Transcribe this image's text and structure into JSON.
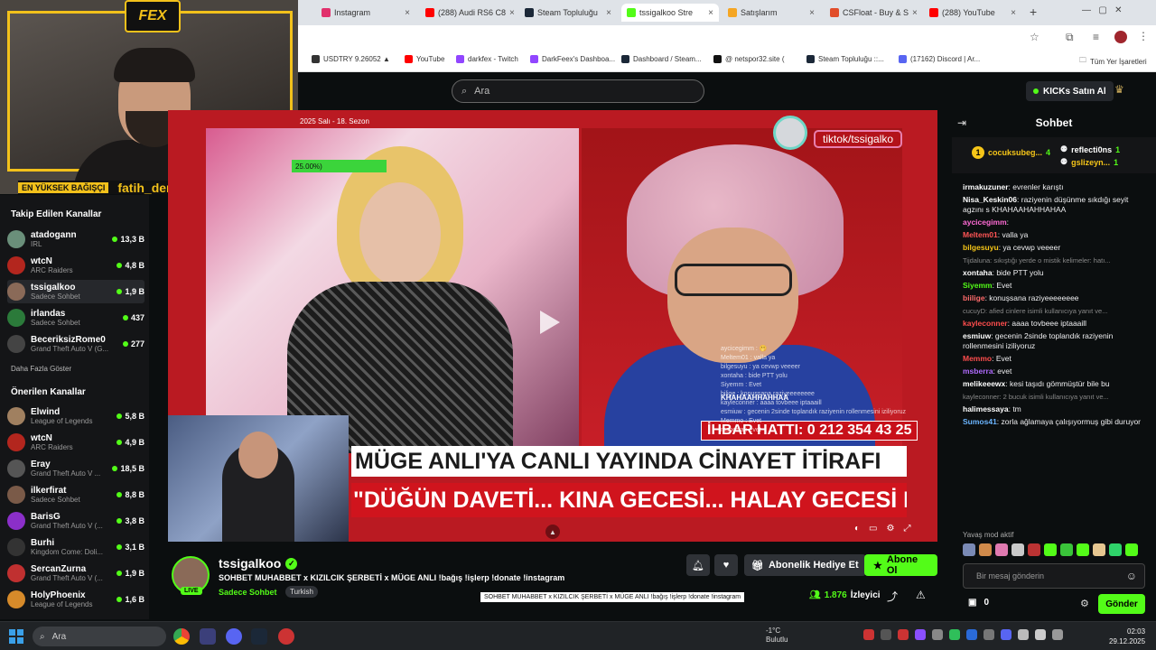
{
  "browser": {
    "tabs": [
      {
        "label": "Instagram",
        "color": "#e1306c"
      },
      {
        "label": "(288) Audi RS6 C8",
        "color": "#ff0000"
      },
      {
        "label": "Steam Topluluğu",
        "color": "#1b2838"
      },
      {
        "label": "tssigalkoo Stre",
        "color": "#53fc18",
        "active": true
      },
      {
        "label": "Satışlarım",
        "color": "#f5a623"
      },
      {
        "label": "CSFloat - Buy & S",
        "color": "#e14d2a"
      },
      {
        "label": "(288) YouTube",
        "color": "#ff0000"
      }
    ],
    "bookmarks": [
      {
        "label": "USDTRY 9.26052 ▲",
        "color": "#333"
      },
      {
        "label": "YouTube",
        "color": "#ff0000"
      },
      {
        "label": "darkfex - Twitch",
        "color": "#9146ff"
      },
      {
        "label": "DarkFeex's Dashboa...",
        "color": "#9146ff"
      },
      {
        "label": "Dashboard / Steam...",
        "color": "#1b2838"
      },
      {
        "label": "@ netspor32.site (",
        "color": "#111"
      },
      {
        "label": "Steam Topluluğu ::...",
        "color": "#1b2838"
      },
      {
        "label": "(17162) Discord | Ar...",
        "color": "#5865f2"
      }
    ],
    "all_bookmarks": "Tüm Yer İşaretleri"
  },
  "kick": {
    "search_placeholder": "Ara",
    "kicks_button": "KICKs Satın Al"
  },
  "overlay": {
    "logo": "FEX",
    "top_donation_label": "EN YÜKSEK BAĞIŞÇI",
    "top_donation_name": "fatih_demircioglu: TRY"
  },
  "sidebar": {
    "followed_heading": "Takip Edilen Kanallar",
    "followed": [
      {
        "name": "atadogann",
        "category": "IRL",
        "viewers": "13,3 B",
        "color": "#6a8f7a"
      },
      {
        "name": "wtcN",
        "category": "ARC Raiders",
        "viewers": "4,8 B",
        "color": "#b3261e"
      },
      {
        "name": "tssigalkoo",
        "category": "Sadece Sohbet",
        "viewers": "1,9 B",
        "color": "#8a6a58",
        "active": true
      },
      {
        "name": "irlandas",
        "category": "Sadece Sohbet",
        "viewers": "437",
        "color": "#2b7a3a"
      },
      {
        "name": "BeceriksizRome0",
        "category": "Grand Theft Auto V (G...",
        "viewers": "277",
        "color": "#444"
      }
    ],
    "show_more": "Daha Fazla Göster",
    "recommended_heading": "Önerilen Kanallar",
    "recommended": [
      {
        "name": "Elwind",
        "category": "League of Legends",
        "viewers": "5,8 B",
        "color": "#a08060"
      },
      {
        "name": "wtcN",
        "category": "ARC Raiders",
        "viewers": "4,9 B",
        "color": "#b3261e"
      },
      {
        "name": "Eray",
        "category": "Grand Theft Auto V ...",
        "viewers": "18,5 B",
        "color": "#555"
      },
      {
        "name": "ilkerfirat",
        "category": "Sadece Sohbet",
        "viewers": "8,8 B",
        "color": "#7a5a48"
      },
      {
        "name": "BarisG",
        "category": "Grand Theft Auto V (...",
        "viewers": "3,8 B",
        "color": "#8b2fc9"
      },
      {
        "name": "Burhi",
        "category": "Kingdom Come: Doli...",
        "viewers": "3,1 B",
        "color": "#333"
      },
      {
        "name": "SercanZurna",
        "category": "Grand Theft Auto V (...",
        "viewers": "1,9 B",
        "color": "#c03030"
      },
      {
        "name": "HolyPhoenix",
        "category": "League of Legends",
        "viewers": "1,6 B",
        "color": "#d68a2a"
      }
    ]
  },
  "video": {
    "tv_date": "2025 Salı - 18. Sezon",
    "progress_text": "25.00%)",
    "tiktok": "tiktok/tssigalko",
    "guest_caption": "KHAHAAHHAHHAA",
    "hotline": "İHBAR HATTI: 0 212 354 43 25",
    "headline1": "MÜGE ANLI'YA CANLI YAYINDA CİNAYET İTİRAFI",
    "headline2": "\"DÜĞÜN DAVETİ... KINA GECESİ... HALAY GECESİ ERCAN'IN KIZIMI ÖLDÜRDÜĞÜNÜ ANLADIM\"",
    "chat_overlay": [
      "aycicegimm : 🫢",
      "Meltem01 : valla ya",
      "bilgesuyu : ya cevwp veeeer",
      "xontaha : bide PTT yolu",
      "Siyemm : Evet",
      "bilige : konuşsana raziyeeeeeeee",
      "kayleconner : aaaa tovbeee iptaaaill",
      "esmiuw : gecenin 2sinde toplandık raziyenin rollenmesini iziliyoruz",
      "Memmo : Evet",
      "msberra : evet"
    ]
  },
  "stream": {
    "streamer": "tssigalkoo",
    "title": "SOHBET MUHABBET x KIZILCIK ŞERBETİ x MÜGE ANLI !bağış !işlerp !donate !instagram",
    "category": "Sadece Sohbet",
    "language": "Turkish",
    "live": "LIVE",
    "gift_sub": "Abonelik Hediye Et",
    "subscribe": "Abone Ol",
    "viewer_count": "1.876",
    "viewer_label": "İzleyici",
    "tooltip": "SOHBET MUHABBET x KIZILCIK ŞERBETİ x MÜGE ANLI !bağış !işlerp !donate !instagram"
  },
  "chat": {
    "title": "Sohbet",
    "gifters": [
      {
        "rank": "1",
        "name": "cocuksubeg...",
        "count": "4",
        "color": "#f5c518"
      },
      {
        "rank": "",
        "name": "reflecti0ns",
        "count": "1",
        "color": "#fff"
      },
      {
        "rank": "",
        "name": "gslizeyn...",
        "count": "1",
        "color": "#f5c518"
      }
    ],
    "messages": [
      {
        "user": "irmakuzuner",
        "text": "evrenler karıştı",
        "color": "#fff"
      },
      {
        "user": "Nisa_Keskin06",
        "text": "raziyenin düşünme sıkdığı seyit agzını s KHAHAAHAHHAHAA",
        "color": "#fff"
      },
      {
        "user": "aycicegimm",
        "text": "",
        "color": "#ff6bd5"
      },
      {
        "user": "Meltem01",
        "text": "valla ya",
        "color": "#ff5555"
      },
      {
        "user": "bilgesuyu",
        "text": "ya cevwp veeeer",
        "color": "#f5c518"
      },
      {
        "user": "",
        "text": "Tijdaluna: sıkıştığı yerde o mistik kelimeler: hatı...",
        "color": "#888",
        "sys": true
      },
      {
        "user": "xontaha",
        "text": "bide PTT yolu",
        "color": "#fff"
      },
      {
        "user": "Siyemm",
        "text": "Evet",
        "color": "#53fc18"
      },
      {
        "user": "biilige",
        "text": "konuşsana raziyeeeeeeee",
        "color": "#ff6b6b"
      },
      {
        "user": "",
        "text": "cucuyD: afied cinlere isimli kullanıcıya yanıt ve...",
        "color": "#888",
        "sys": true
      },
      {
        "user": "kayleconner",
        "text": "aaaa tovbeee iptaaaill",
        "color": "#ff4d4d"
      },
      {
        "user": "esmiuw",
        "text": "gecenin 2sinde toplandık raziyenin rollenmesini iziliyoruz",
        "color": "#fff"
      },
      {
        "user": "Memmo",
        "text": "Evet",
        "color": "#ff4d4d"
      },
      {
        "user": "msberra",
        "text": "evet",
        "color": "#b06bff"
      },
      {
        "user": "melikeeewx",
        "text": "kesi taşıdı gömmüştür bile bu",
        "color": "#fff"
      },
      {
        "user": "",
        "text": "kayleconner: 2 bucuk isimli kullanıcıya yanıt ve...",
        "color": "#888",
        "sys": true
      },
      {
        "user": "halimessaya",
        "text": "tm",
        "color": "#fff"
      },
      {
        "user": "Sumos41",
        "text": "zorla ağlamaya çalışıyormuş gibi duruyor",
        "color": "#6bb5ff"
      }
    ],
    "slow_mode": "Yavaş mod aktif",
    "input_placeholder": "Bir mesaj gönderin",
    "points": "0",
    "send": "Gönder"
  },
  "taskbar": {
    "search_placeholder": "Ara",
    "weather_temp": "-1°C",
    "weather_desc": "Bulutlu",
    "time": "02:03",
    "date": "29.12.2025"
  }
}
